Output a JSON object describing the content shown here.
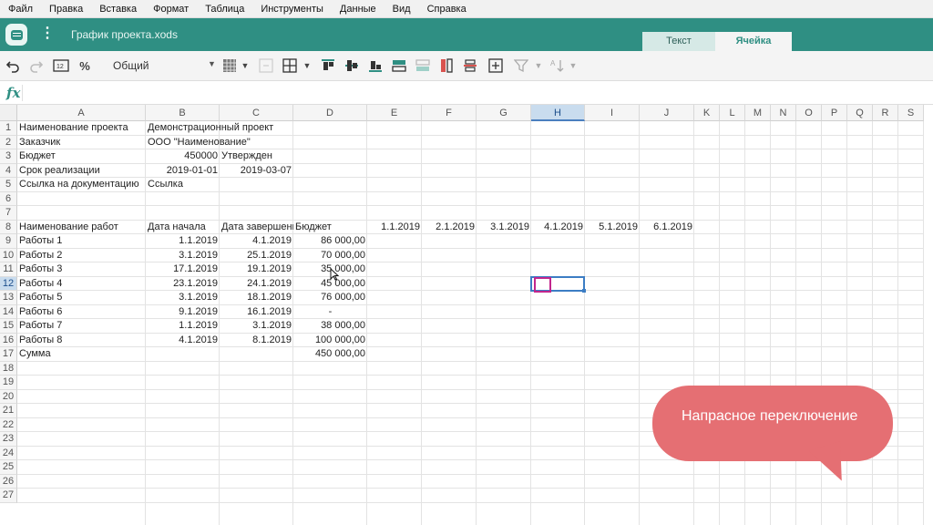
{
  "menu": [
    "Файл",
    "Правка",
    "Вставка",
    "Формат",
    "Таблица",
    "Инструменты",
    "Данные",
    "Вид",
    "Справка"
  ],
  "titlebar": {
    "document_title": "График проекта.xods",
    "tabs": [
      {
        "label": "Текст",
        "active": false
      },
      {
        "label": "Ячейка",
        "active": true
      }
    ],
    "accent_color": "#2f8f83"
  },
  "toolbar": {
    "number_format": "Общий",
    "icons": [
      "undo-icon",
      "redo-icon",
      "number-format-icon",
      "percent-icon",
      "format-dropdown-icon",
      "fill-color-icon",
      "merge-cells-icon",
      "borders-icon",
      "align-top-icon",
      "align-middle-icon",
      "align-bottom-icon",
      "insert-row-above-icon",
      "insert-row-below-icon",
      "insert-column-left-icon",
      "insert-column-right-icon",
      "insert-cell-icon",
      "filter-icon",
      "sort-icon"
    ]
  },
  "formula": {
    "value": ""
  },
  "grid": {
    "columns": [
      "A",
      "B",
      "C",
      "D",
      "E",
      "F",
      "G",
      "H",
      "I",
      "J",
      "K",
      "L",
      "M",
      "N",
      "O",
      "P",
      "Q",
      "R",
      "S"
    ],
    "selected_column": "H",
    "rows": [
      "1",
      "2",
      "3",
      "4",
      "5",
      "6",
      "7",
      "8",
      "9",
      "10",
      "11",
      "12",
      "13",
      "14",
      "15",
      "16",
      "17",
      "18",
      "19",
      "20",
      "21",
      "22",
      "23",
      "24",
      "25",
      "26",
      "27"
    ],
    "selected_row": "12",
    "selected_cell": "H12",
    "cells": {
      "A1": "Наименование проекта",
      "B1": "Демонстрационный проект",
      "A2": "Заказчик",
      "B2": "ООО \"Наименование\"",
      "A3": "Бюджет",
      "B3": "450000",
      "C3": "Утвержден",
      "A4": "Срок реализации",
      "B4": "2019-01-01",
      "C4": "2019-03-07",
      "A5": "Ссылка на документацию",
      "B5": "Ссылка",
      "A8": "Наименование работ",
      "B8": "Дата начала",
      "C8": "Дата завершения",
      "D8": "Бюджет",
      "E8": "1.1.2019",
      "F8": "2.1.2019",
      "G8": "3.1.2019",
      "H8": "4.1.2019",
      "I8": "5.1.2019",
      "J8": "6.1.2019",
      "A9": "Работы 1",
      "B9": "1.1.2019",
      "C9": "4.1.2019",
      "D9": "86 000,00",
      "A10": "Работы 2",
      "B10": "3.1.2019",
      "C10": "25.1.2019",
      "D10": "70 000,00",
      "A11": "Работы 3",
      "B11": "17.1.2019",
      "C11": "19.1.2019",
      "D11": "35 000,00",
      "A12": "Работы 4",
      "B12": "23.1.2019",
      "C12": "24.1.2019",
      "D12": "45 000,00",
      "A13": "Работы 5",
      "B13": "3.1.2019",
      "C13": "18.1.2019",
      "D13": "76 000,00",
      "A14": "Работы 6",
      "B14": "9.1.2019",
      "C14": "16.1.2019",
      "D14": "-",
      "A15": "Работы 7",
      "B15": "1.1.2019",
      "C15": "3.1.2019",
      "D15": "38 000,00",
      "A16": "Работы 8",
      "B16": "4.1.2019",
      "C16": "8.1.2019",
      "D16": "100 000,00",
      "A17": "Сумма",
      "D17": "450 000,00"
    }
  },
  "callout": {
    "text": "Напрасное переключение",
    "color": "#e56f73"
  }
}
